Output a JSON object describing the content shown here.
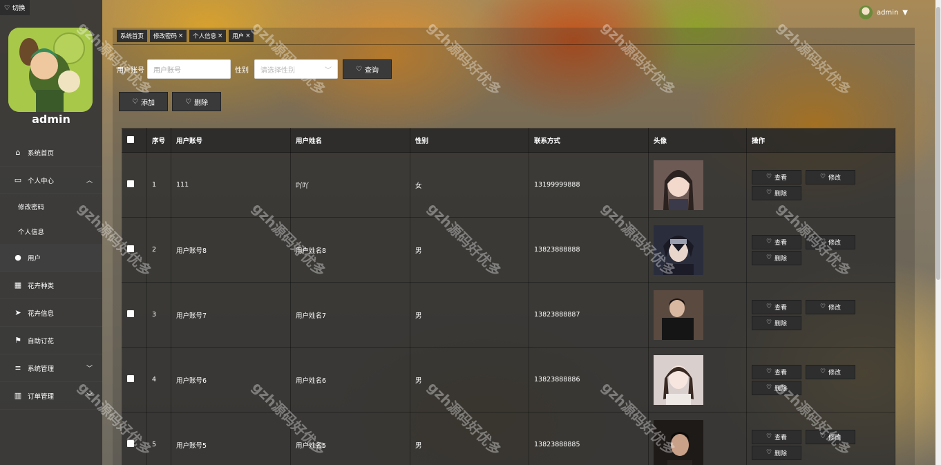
{
  "toggle_label": "切换",
  "sidebar": {
    "admin_name": "admin",
    "items": [
      {
        "label": "系统首页",
        "icon": "home-icon"
      },
      {
        "label": "个人中心",
        "icon": "profile-icon"
      },
      {
        "label": "修改密码"
      },
      {
        "label": "个人信息"
      },
      {
        "label": "用户",
        "icon": "bulb-icon"
      },
      {
        "label": "花卉种类",
        "icon": "grid-icon"
      },
      {
        "label": "花卉信息",
        "icon": "send-icon"
      },
      {
        "label": "自助订花",
        "icon": "flag-icon"
      },
      {
        "label": "系统管理",
        "icon": "list-icon"
      },
      {
        "label": "订单管理",
        "icon": "bar-chart-icon"
      }
    ]
  },
  "topbar": {
    "username": "admin"
  },
  "tabs": [
    {
      "label": "系统首页",
      "close": ""
    },
    {
      "label": "修改密码",
      "close": "×"
    },
    {
      "label": "个人信息",
      "close": "×"
    },
    {
      "label": "用户",
      "close": "×"
    }
  ],
  "search": {
    "account_label": "用户账号",
    "account_placeholder": "用户账号",
    "gender_label": "性别",
    "gender_placeholder": "请选择性别",
    "query_label": "查询"
  },
  "actions": {
    "add_label": "添加",
    "delete_label": "删除"
  },
  "table": {
    "headers": [
      "序号",
      "用户账号",
      "用户姓名",
      "性别",
      "联系方式",
      "头像",
      "操作"
    ],
    "rows": [
      {
        "no": "1",
        "account": "111",
        "name": "吖吖",
        "gender": "女",
        "phone": "13199999888",
        "photo_color": "#6d5a55"
      },
      {
        "no": "2",
        "account": "用户账号8",
        "name": "用户姓名8",
        "gender": "男",
        "phone": "13823888888",
        "photo_color": "#2a2d3c"
      },
      {
        "no": "3",
        "account": "用户账号7",
        "name": "用户姓名7",
        "gender": "男",
        "phone": "13823888887",
        "photo_color": "#5b4a40"
      },
      {
        "no": "4",
        "account": "用户账号6",
        "name": "用户姓名6",
        "gender": "男",
        "phone": "13823888886",
        "photo_color": "#d9cfcc"
      },
      {
        "no": "5",
        "account": "用户账号5",
        "name": "用户姓名5",
        "gender": "男",
        "phone": "13823888885",
        "photo_color": "#1e1a18"
      }
    ],
    "view_label": "查看",
    "edit_label": "修改",
    "delete_label": "删除"
  },
  "watermark": "gzh源码好优多"
}
